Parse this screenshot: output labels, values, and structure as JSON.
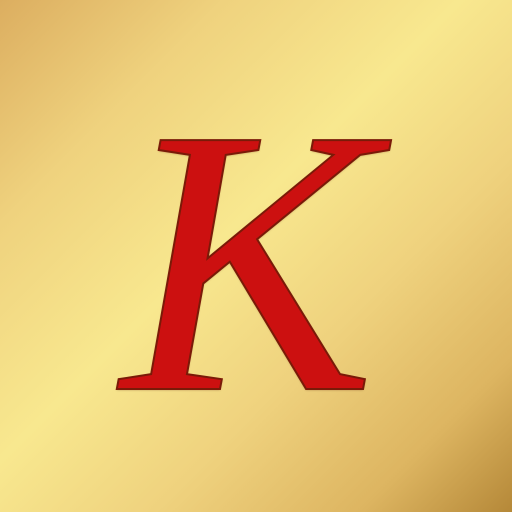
{
  "icon": {
    "letter": "K",
    "letter_color": "#cc1010",
    "background_colors": [
      "#dcae60",
      "#f8e88f",
      "#b58838"
    ]
  }
}
